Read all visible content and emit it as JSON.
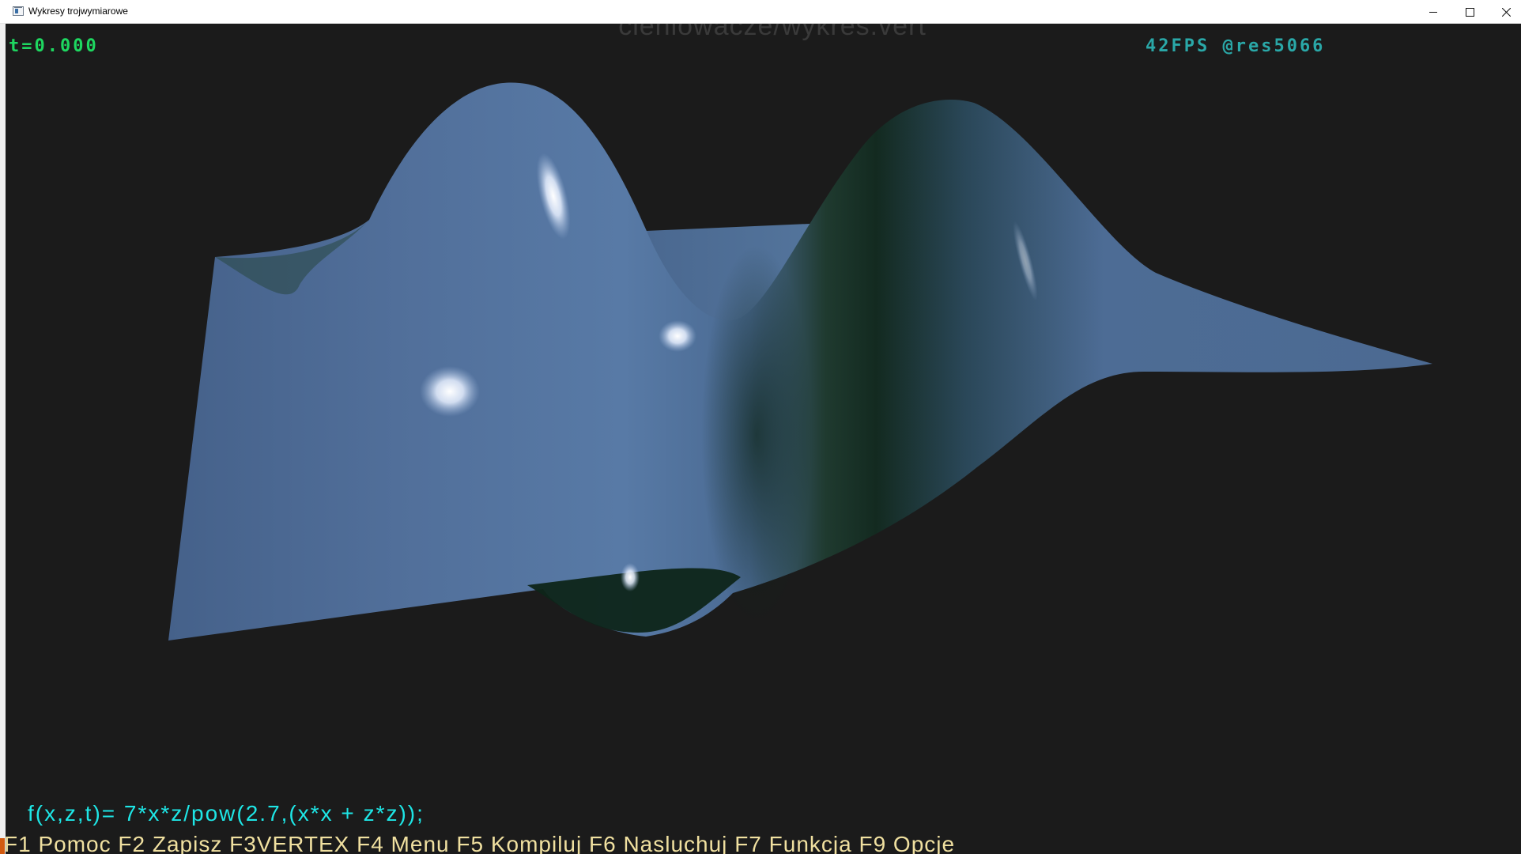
{
  "window": {
    "title": "Wykresy trojwymiarowe"
  },
  "overlay": {
    "shader_name": "cieniowacze/wykres.vert",
    "time": "t=0.000",
    "fps": "42FPS @res5066",
    "function": "f(x,z,t)= 7*x*z/pow(2.7,(x*x + z*z));"
  },
  "function_keys": [
    "F1 Pomoc",
    "F2 Zapisz",
    "F3VERTEX",
    "F4 Menu",
    "F5 Kompiluj",
    "F6 Nasluchuj",
    "F7 Funkcja",
    "F9 Opcje"
  ],
  "colors": {
    "background": "#1b1b1b",
    "surface": "#4e6d96",
    "time_text": "#1ed760",
    "fps_text": "#2aa8a8",
    "function_text": "#1ee6e6",
    "keys_text": "#f0e0a0"
  },
  "icons": {
    "app": "window-app-icon",
    "minimize": "minimize-icon",
    "maximize": "maximize-icon",
    "close": "close-icon"
  }
}
